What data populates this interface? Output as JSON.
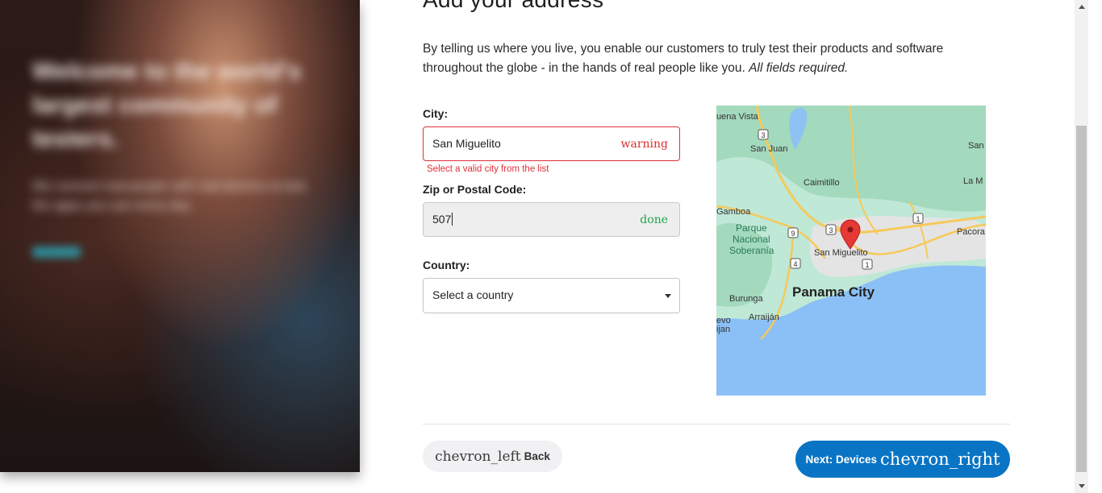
{
  "promo": {
    "title": "Welcome to the world's largest community of testers.",
    "body": "We connect real people with real devices to test the apps you use every day.",
    "link_label": "Learn"
  },
  "page": {
    "heading": "Add your address",
    "intro_text": "By telling us where you live, you enable our customers to truly test their products and software throughout the globe - in the hands of real people like you. ",
    "intro_required": "All fields required."
  },
  "form": {
    "city": {
      "label": "City:",
      "value": "San Miguelito",
      "status_icon": "warning",
      "error": "Select a valid city from the list"
    },
    "zip": {
      "label": "Zip or Postal Code:",
      "value": "507",
      "status_icon": "done"
    },
    "country": {
      "label": "Country:",
      "value": "Select a country"
    }
  },
  "map": {
    "labels": {
      "buena_vista": "uena Vista",
      "san_juan": "San Juan",
      "caimitillo": "Caimitillo",
      "san_right": "San",
      "la_m": "La M",
      "gamboa": "Gamboa",
      "parque": "Parque",
      "nacional": "Nacional",
      "soberania": "Soberanía",
      "pacora": "Pacora",
      "san_miguelito": "San Miguelito",
      "panama_city": "Panama City",
      "burunga": "Burunga",
      "arraijan": "Arraiján",
      "evo": "evo",
      "ijan": "ijan"
    },
    "routes": [
      "3",
      "1",
      "9",
      "3",
      "4",
      "1"
    ]
  },
  "nav": {
    "back_icon": "chevron_left",
    "back_label": "Back",
    "next_label": "Next: Devices",
    "next_icon": "chevron_right"
  },
  "colors": {
    "error": "#e0303a",
    "success": "#1fa34a",
    "primary": "#0a74c4"
  }
}
